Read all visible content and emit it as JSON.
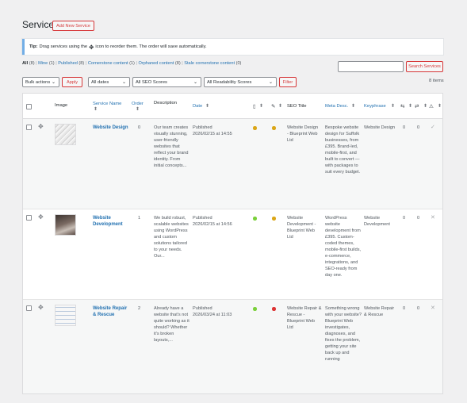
{
  "header": {
    "title": "Services",
    "add_new": "Add New Service"
  },
  "tip": {
    "label": "Tip:",
    "text_before": "Drag services using the",
    "drag_glyph": "✥",
    "text_after": "icon to reorder them. The order will save automatically."
  },
  "views": {
    "all": "All",
    "all_count": "(8)",
    "mine": "Mine",
    "mine_count": "(1)",
    "published": "Published",
    "published_count": "(8)",
    "cornerstone": "Cornerstone content",
    "cornerstone_count": "(1)",
    "orphaned": "Orphaned content",
    "orphaned_count": "(8)",
    "stale": "Stale cornerstone content",
    "stale_count": "(0)",
    "sep": "|"
  },
  "search": {
    "value": "",
    "button": "Search Services"
  },
  "filters": {
    "bulk_actions": "Bulk actions",
    "apply": "Apply",
    "dates": "All dates",
    "seo": "All SEO Scores",
    "readability": "All Readability Scores",
    "filter": "Filter",
    "items": "8 items"
  },
  "columns": {
    "image": "Image",
    "service_name": "Service Name",
    "order": "Order",
    "description": "Description",
    "date": "Date",
    "seo_title": "SEO Title",
    "meta_desc": "Meta Desc.",
    "keyphrase": "Keyphrase",
    "sort_glyph": "⬍"
  },
  "rows": [
    {
      "name": "Website Design",
      "order": "0",
      "description": "Our team creates visually stunning, user-friendly websites that reflect your brand identity. From initial concepts...",
      "date_status": "Published",
      "date_value": "2026/02/15 at 14:55",
      "seo_dot": "#dba617",
      "read_dot": "#dba617",
      "seo_title": "Website Design - Blueprint Web Ltd",
      "meta_desc": "Bespoke website design for Suffolk businesses, from £395. Brand-led, mobile-first, and built to convert — with packages to suit every budget.",
      "keyphrase": "Website Design",
      "links_out": "0",
      "links_in": "0",
      "status_icon": "✓"
    },
    {
      "name": "Website Development",
      "order": "1",
      "description": "We build robust, scalable websites using WordPress and custom solutions tailored to your needs. Our...",
      "date_status": "Published",
      "date_value": "2026/02/15 at 14:56",
      "seo_dot": "#7ad03a",
      "read_dot": "#dba617",
      "seo_title": "Website Development - Blueprint Web Ltd",
      "meta_desc": "WordPress website development from £395. Custom-coded themes, mobile-first builds, e-commerce, integrations, and SEO-ready from day one.",
      "keyphrase": "Website Development",
      "links_out": "0",
      "links_in": "0",
      "status_icon": "✕"
    },
    {
      "name": "Website Repair & Rescue",
      "order": "2",
      "description": "Already have a website that's not quite working as it should? Whether it's broken layouts,...",
      "date_status": "Published",
      "date_value": "2026/03/24 at 11:03",
      "seo_dot": "#7ad03a",
      "read_dot": "#dc3232",
      "seo_title": "Website Repair & Rescue - Blueprint Web Ltd",
      "meta_desc": "Something wrong with your website? Blueprint Web investigates, diagnoses, and fixes the problem, getting your site back up and running",
      "keyphrase": "Website Repair & Rescue",
      "links_out": "0",
      "links_in": "0",
      "status_icon": "✕"
    }
  ]
}
